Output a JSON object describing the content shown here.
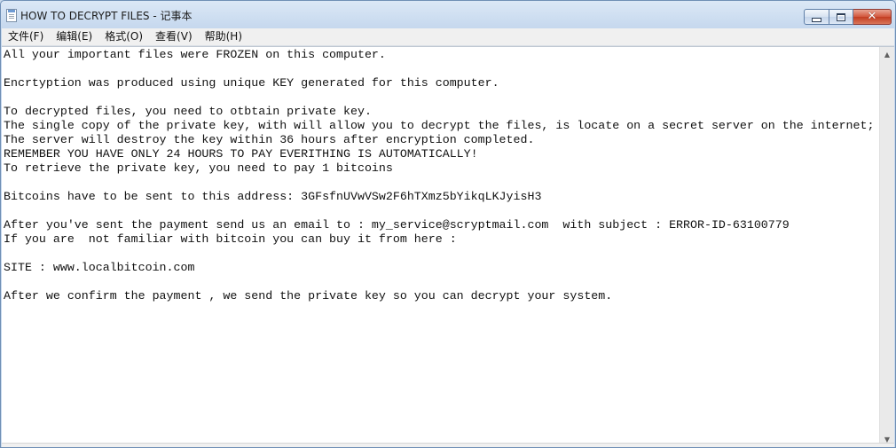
{
  "window": {
    "title": "HOW TO DECRYPT FILES - 记事本",
    "controls": {
      "minimize": "",
      "maximize": "",
      "close": "✕"
    }
  },
  "menu": [
    {
      "label": "文件(F)"
    },
    {
      "label": "编辑(E)"
    },
    {
      "label": "格式(O)"
    },
    {
      "label": "查看(V)"
    },
    {
      "label": "帮助(H)"
    }
  ],
  "document": {
    "lines": [
      "All your important files were FROZEN on this computer.",
      "",
      "Encrtyption was produced using unique KEY generated for this computer.",
      "",
      "To decrypted files, you need to otbtain private key.",
      "The single copy of the private key, with will allow you to decrypt the files, is locate on a secret server on the internet;",
      "The server will destroy the key within 36 hours after encryption completed.",
      "REMEMBER YOU HAVE ONLY 24 HOURS TO PAY EVERITHING IS AUTOMATICALLY!",
      "To retrieve the private key, you need to pay 1 bitcoins",
      "",
      "Bitcoins have to be sent to this address: 3GFsfnUVwVSw2F6hTXmz5bYikqLKJyisH3",
      "",
      "After you've sent the payment send us an email to : my_service@scryptmail.com  with subject : ERROR-ID-63100779",
      "If you are  not familiar with bitcoin you can buy it from here :",
      "",
      "SITE : www.localbitcoin.com",
      "",
      "After we confirm the payment , we send the private key so you can decrypt your system."
    ]
  },
  "icons": {
    "app": "notepad-icon",
    "scroll_up": "chevron-up-icon",
    "scroll_down": "chevron-down-icon"
  },
  "colors": {
    "titlebar": "#c6d8ee",
    "close_button": "#c23d22",
    "text": "#111111",
    "background": "#ffffff"
  }
}
